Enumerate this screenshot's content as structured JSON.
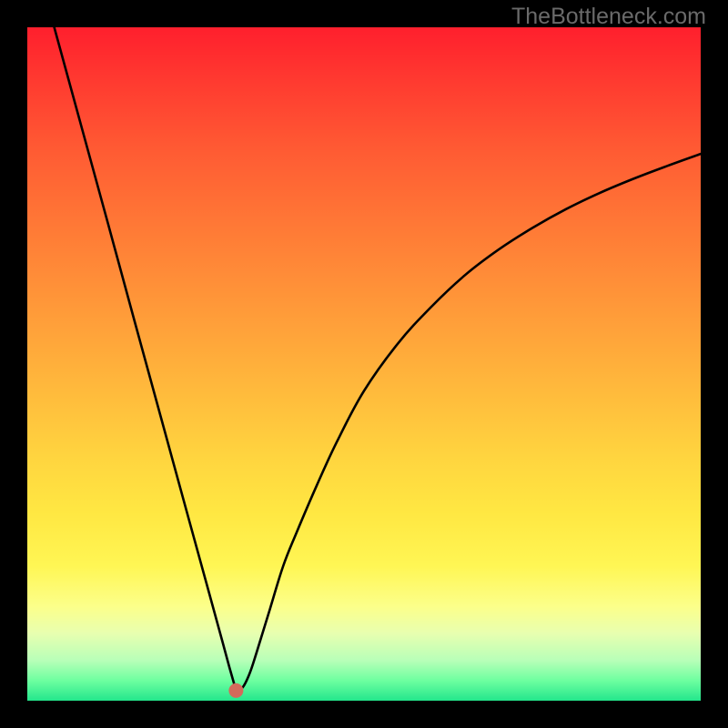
{
  "watermark": "TheBottleneck.com",
  "chart_data": {
    "type": "line",
    "title": "",
    "xlabel": "",
    "ylabel": "",
    "xlim": [
      0,
      100
    ],
    "ylim": [
      0,
      100
    ],
    "background_gradient": {
      "top": "#ff1f2d",
      "bottom": "#23e68c"
    },
    "curve_color": "#000000",
    "curve_description": "V-shaped bottleneck curve with a steep linear left descent, a sharp minimum near x≈31, then a concave-upward recovery on the right that asymptotes toward y≈82",
    "series": [
      {
        "name": "bottleneck-curve",
        "x": [
          4,
          8,
          12,
          16,
          20,
          24,
          27,
          29,
          30,
          31,
          32,
          33,
          34,
          36,
          38,
          40,
          43,
          46,
          50,
          55,
          60,
          65,
          70,
          75,
          80,
          85,
          90,
          95,
          100
        ],
        "y": [
          100,
          85.4,
          70.8,
          56.1,
          41.5,
          26.9,
          16.0,
          8.7,
          5.0,
          1.5,
          2.0,
          4.0,
          7.0,
          13.5,
          20.0,
          25.0,
          32.0,
          38.5,
          46.0,
          53.0,
          58.5,
          63.2,
          67.0,
          70.2,
          73.0,
          75.4,
          77.5,
          79.4,
          81.2
        ]
      }
    ],
    "marker": {
      "x": 31,
      "y": 1.5,
      "color": "#d46a5b",
      "radius_px": 8
    }
  }
}
